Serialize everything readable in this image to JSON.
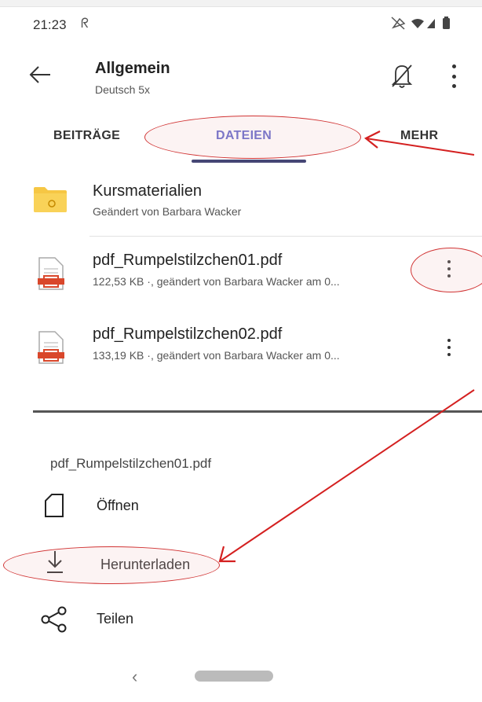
{
  "status_bar": {
    "time": "21:23"
  },
  "header": {
    "title": "Allgemein",
    "subtitle": "Deutsch 5x"
  },
  "tabs": [
    {
      "label": "BEITRÄGE",
      "active": false
    },
    {
      "label": "DATEIEN",
      "active": true
    },
    {
      "label": "MEHR",
      "active": false
    }
  ],
  "files": [
    {
      "name": "Kursmaterialien",
      "meta": "Geändert von Barbara Wacker",
      "icon": "folder-icon"
    },
    {
      "name": "pdf_Rumpelstilzchen01.pdf",
      "meta": "122,53 KB ·, geändert von Barbara Wacker am 0...",
      "icon": "pdf-file-icon"
    },
    {
      "name": "pdf_Rumpelstilzchen02.pdf",
      "meta": "133,19 KB ·, geändert von Barbara Wacker am 0...",
      "icon": "pdf-file-icon"
    }
  ],
  "sheet": {
    "title": "pdf_Rumpelstilzchen01.pdf",
    "actions": [
      {
        "label": "Öffnen",
        "icon": "open-file-icon"
      },
      {
        "label": "Herunterladen",
        "icon": "download-icon"
      },
      {
        "label": "Teilen",
        "icon": "share-icon"
      }
    ]
  },
  "colors": {
    "accent": "#5b5fc7",
    "tab_indicator": "#464775",
    "annotation": "#d13434",
    "folder": "#f6c744",
    "pdf": "#d9472b"
  }
}
